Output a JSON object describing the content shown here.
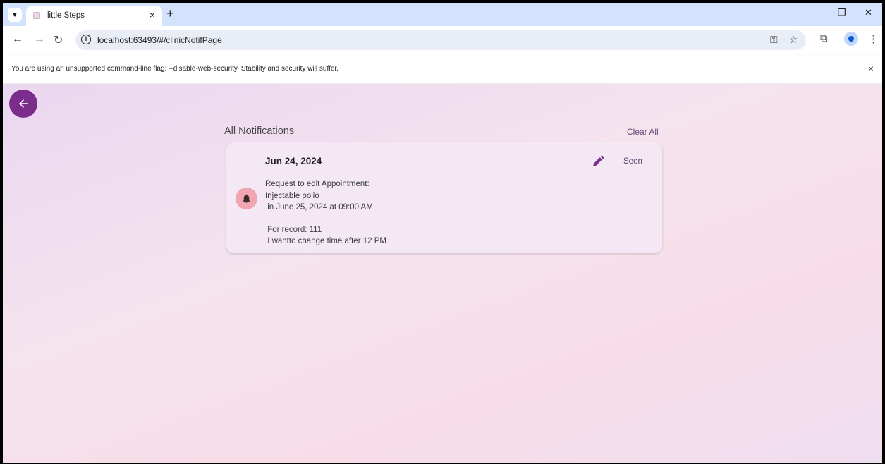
{
  "browser": {
    "tab_title": "little Steps",
    "tab_close": "×",
    "new_tab": "+",
    "url": "localhost:63493/#/clinicNotifPage",
    "window_controls": {
      "minimize": "–",
      "restore": "❐",
      "close": "✕"
    },
    "icons": [
      "tab-search-icon",
      "back-icon",
      "forward-icon",
      "reload-icon",
      "info-icon",
      "password-key-icon",
      "bookmark-star-icon",
      "extensions-icon",
      "profile-icon",
      "menu-dots-icon"
    ]
  },
  "infobar": {
    "message": "You are using an unsupported command-line flag: --disable-web-security. Stability and security will suffer.",
    "close": "×"
  },
  "page": {
    "section_title": "All Notifications",
    "clear_all": "Clear All",
    "accent_color": "#7b2d8b",
    "notifications": [
      {
        "date": "Jun 24, 2024",
        "action": "Seen",
        "line1": "Request to edit Appointment:",
        "line2": "Injectable polio",
        "line3": " in June 25, 2024 at 09:00 AM",
        "line4": " For record: 111",
        "line5": " I wantto change time after 12 PM"
      }
    ]
  }
}
